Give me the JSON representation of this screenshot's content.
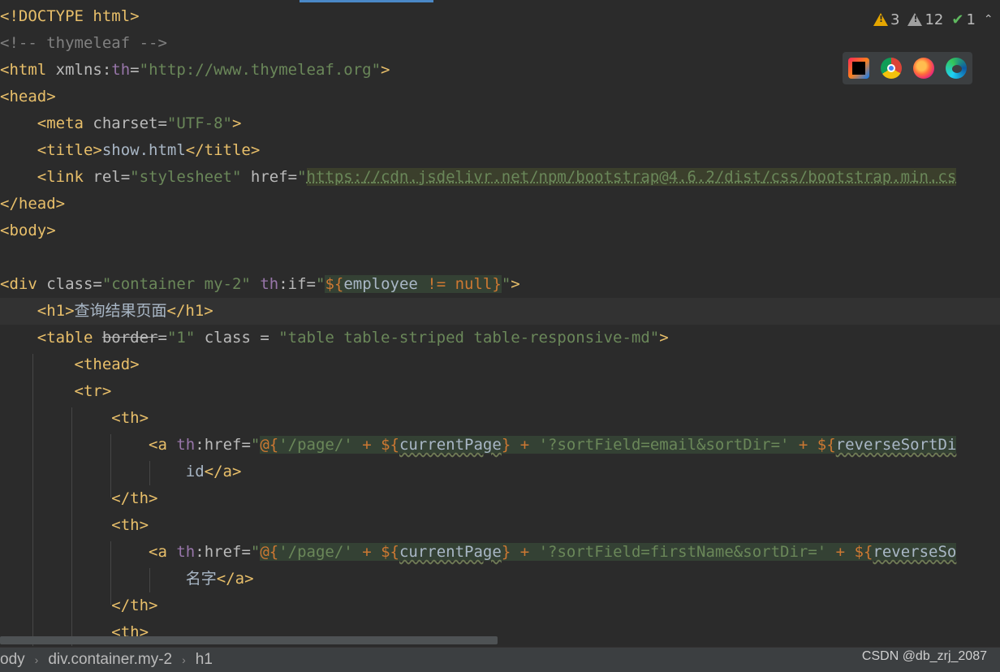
{
  "editor": {
    "lines": [
      [
        {
          "t": "<!DOCTYPE html>",
          "c": "t-tag"
        }
      ],
      [
        {
          "t": "<!-- thymeleaf -->",
          "c": "t-comment"
        }
      ],
      [
        {
          "t": "<html",
          "c": "t-tag"
        },
        {
          "t": " xmlns:",
          "c": "t-attr"
        },
        {
          "t": "th",
          "c": "t-ns"
        },
        {
          "t": "=",
          "c": "t-attr"
        },
        {
          "t": "\"http://www.thymeleaf.org\"",
          "c": "t-str"
        },
        {
          "t": ">",
          "c": "t-tag"
        }
      ],
      [
        {
          "t": "<head>",
          "c": "t-tag"
        }
      ],
      [
        {
          "t": "    <meta",
          "c": "t-tag"
        },
        {
          "t": " charset=",
          "c": "t-attr"
        },
        {
          "t": "\"UTF-8\"",
          "c": "t-str"
        },
        {
          "t": ">",
          "c": "t-tag"
        }
      ],
      [
        {
          "t": "    <title>",
          "c": "t-tag"
        },
        {
          "t": "show.html",
          "c": "t-text"
        },
        {
          "t": "</title>",
          "c": "t-tag"
        }
      ],
      [
        {
          "t": "    <link",
          "c": "t-tag"
        },
        {
          "t": " rel=",
          "c": "t-attr"
        },
        {
          "t": "\"stylesheet\"",
          "c": "t-str"
        },
        {
          "t": " href=",
          "c": "t-attr"
        },
        {
          "t": "\"",
          "c": "t-str"
        },
        {
          "t": "https://cdn.jsdelivr.net/npm/bootstrap@4.6.2/dist/css/bootstrap.min.cs",
          "c": "t-url"
        }
      ],
      [
        {
          "t": "</head>",
          "c": "t-tag"
        }
      ],
      [
        {
          "t": "<body>",
          "c": "t-tag"
        }
      ],
      [],
      [
        {
          "t": "<div",
          "c": "t-tag"
        },
        {
          "t": " class=",
          "c": "t-attr"
        },
        {
          "t": "\"container my-2\"",
          "c": "t-str"
        },
        {
          "t": " ",
          "c": "t-attr"
        },
        {
          "t": "th",
          "c": "t-ns"
        },
        {
          "t": ":if=",
          "c": "t-attr"
        },
        {
          "t": "\"",
          "c": "t-str"
        },
        {
          "t": "${",
          "c": "t-op t-exprbg"
        },
        {
          "t": "employee ",
          "c": "t-text t-exprbg"
        },
        {
          "t": "!= null",
          "c": "t-op t-exprbg"
        },
        {
          "t": "}",
          "c": "t-op t-exprbg"
        },
        {
          "t": "\"",
          "c": "t-str"
        },
        {
          "t": ">",
          "c": "t-tag"
        }
      ],
      [
        {
          "t": "    <h1>",
          "c": "t-tag"
        },
        {
          "t": "查询结果页面",
          "c": "t-text t-cjk"
        },
        {
          "t": "</h1>",
          "c": "t-tag"
        }
      ],
      [
        {
          "t": "    <table",
          "c": "t-tag"
        },
        {
          "t": " ",
          "c": "t-attr"
        },
        {
          "t": "border",
          "c": "t-strike"
        },
        {
          "t": "=",
          "c": "t-attr"
        },
        {
          "t": "\"1\"",
          "c": "t-str"
        },
        {
          "t": " class = ",
          "c": "t-attr"
        },
        {
          "t": "\"table table-striped table-responsive-md\"",
          "c": "t-str"
        },
        {
          "t": ">",
          "c": "t-tag"
        }
      ],
      [
        {
          "t": "        <thead>",
          "c": "t-tag"
        }
      ],
      [
        {
          "t": "        <tr>",
          "c": "t-tag"
        }
      ],
      [
        {
          "t": "            <th>",
          "c": "t-tag"
        }
      ],
      [
        {
          "t": "                <a",
          "c": "t-tag"
        },
        {
          "t": " ",
          "c": "t-attr"
        },
        {
          "t": "th",
          "c": "t-ns"
        },
        {
          "t": ":href=",
          "c": "t-attr"
        },
        {
          "t": "\"",
          "c": "t-str"
        },
        {
          "t": "@{",
          "c": "t-op t-exprbg"
        },
        {
          "t": "'/page/'",
          "c": "t-str t-exprbg"
        },
        {
          "t": " + ",
          "c": "t-op t-exprbg"
        },
        {
          "t": "${",
          "c": "t-op t-exprbg"
        },
        {
          "t": "currentPage",
          "c": "t-var t-exprbg"
        },
        {
          "t": "}",
          "c": "t-op t-exprbg"
        },
        {
          "t": " + ",
          "c": "t-op t-exprbg"
        },
        {
          "t": "'?sortField=email&sortDir='",
          "c": "t-str t-exprbg"
        },
        {
          "t": " + ",
          "c": "t-op t-exprbg"
        },
        {
          "t": "${",
          "c": "t-op t-exprbg"
        },
        {
          "t": "reverseSortDi",
          "c": "t-var t-exprbg"
        }
      ],
      [
        {
          "t": "                    id",
          "c": "t-text"
        },
        {
          "t": "</a>",
          "c": "t-tag"
        }
      ],
      [
        {
          "t": "            </th>",
          "c": "t-tag"
        }
      ],
      [
        {
          "t": "            <th>",
          "c": "t-tag"
        }
      ],
      [
        {
          "t": "                <a",
          "c": "t-tag"
        },
        {
          "t": " ",
          "c": "t-attr"
        },
        {
          "t": "th",
          "c": "t-ns"
        },
        {
          "t": ":href=",
          "c": "t-attr"
        },
        {
          "t": "\"",
          "c": "t-str"
        },
        {
          "t": "@{",
          "c": "t-op t-exprbg"
        },
        {
          "t": "'/page/'",
          "c": "t-str t-exprbg"
        },
        {
          "t": " + ",
          "c": "t-op t-exprbg"
        },
        {
          "t": "${",
          "c": "t-op t-exprbg"
        },
        {
          "t": "currentPage",
          "c": "t-var t-exprbg"
        },
        {
          "t": "}",
          "c": "t-op t-exprbg"
        },
        {
          "t": " + ",
          "c": "t-op t-exprbg"
        },
        {
          "t": "'?sortField=firstName&sortDir='",
          "c": "t-str t-exprbg"
        },
        {
          "t": " + ",
          "c": "t-op t-exprbg"
        },
        {
          "t": "${",
          "c": "t-op t-exprbg"
        },
        {
          "t": "reverseSo",
          "c": "t-var t-exprbg"
        }
      ],
      [
        {
          "t": "                    ",
          "c": "t-text"
        },
        {
          "t": "名字",
          "c": "t-text t-cjk"
        },
        {
          "t": "</a>",
          "c": "t-tag"
        }
      ],
      [
        {
          "t": "            </th>",
          "c": "t-tag"
        }
      ],
      [
        {
          "t": "            <th>",
          "c": "t-tag"
        }
      ]
    ]
  },
  "inspections": {
    "warnings": "3",
    "weak_warnings": "12",
    "typos": "1"
  },
  "browsers": [
    {
      "name": "intellij-idea-icon"
    },
    {
      "name": "chrome-icon"
    },
    {
      "name": "firefox-icon"
    },
    {
      "name": "edge-icon"
    }
  ],
  "breadcrumbs": [
    "ody",
    "div.container.my-2",
    "h1"
  ],
  "watermark": "CSDN @db_zrj_2087"
}
